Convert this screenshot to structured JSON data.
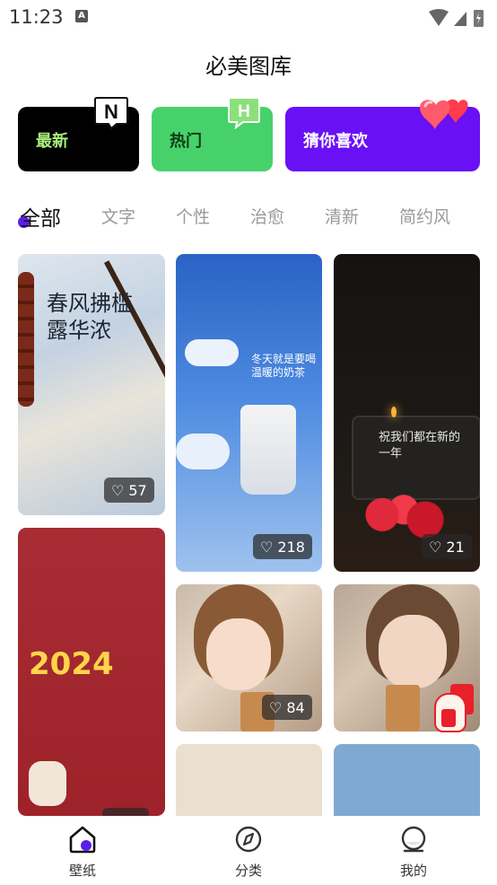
{
  "status": {
    "time": "11:23"
  },
  "app": {
    "title": "必美图库"
  },
  "categories": [
    {
      "label": "最新",
      "badge": "N",
      "color": "#000000"
    },
    {
      "label": "热门",
      "badge": "H",
      "color": "#47d16a"
    },
    {
      "label": "猜你喜欢",
      "badge": "heart",
      "color": "#6a10f5"
    }
  ],
  "tabs": [
    "全部",
    "文字",
    "个性",
    "治愈",
    "清新",
    "简约风"
  ],
  "tiles": [
    {
      "likes": "57",
      "text": "春风拂槛露华浓"
    },
    {
      "likes": "",
      "text": "2024"
    },
    {
      "likes": "218",
      "text": "冬天就是要喝温暖的奶茶"
    },
    {
      "likes": "84",
      "text": ""
    },
    {
      "likes": "21",
      "text": "祝我们都在新的一年"
    },
    {
      "likes": "",
      "text": ""
    }
  ],
  "nav": [
    {
      "label": "壁纸",
      "icon": "home-icon"
    },
    {
      "label": "分类",
      "icon": "compass-icon"
    },
    {
      "label": "我的",
      "icon": "profile-icon"
    }
  ]
}
